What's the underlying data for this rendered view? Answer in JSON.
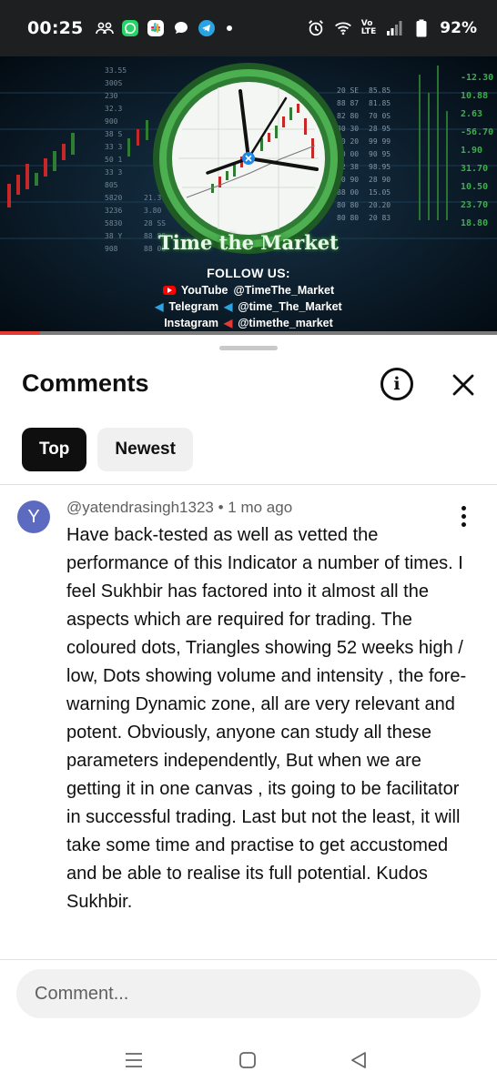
{
  "status_bar": {
    "time": "00:25",
    "left_icons": [
      "group-icon",
      "whatsapp-icon",
      "slack-icon",
      "chat-bubble-icon",
      "telegram-icon",
      "dot-icon"
    ],
    "right_icons": [
      "alarm-icon",
      "wifi-icon",
      "volte-icon",
      "signal-icon",
      "battery-icon"
    ],
    "volte_label_top": "Vo",
    "volte_label_bottom": "LTE",
    "battery": "92%"
  },
  "video": {
    "brand_title": "Time the Market",
    "follow_title": "FOLLOW US:",
    "links": [
      {
        "icon": "youtube-icon",
        "platform": "YouTube",
        "handle": "@TimeThe_Market"
      },
      {
        "icon": "telegram-icon",
        "platform": "Telegram",
        "handle": "@time_The_Market"
      },
      {
        "icon": "instagram-icon",
        "platform": "Instagram",
        "handle": "@timethe_market"
      }
    ],
    "progress_fraction": 0.08,
    "progress_color": "#e53935"
  },
  "comments_sheet": {
    "title": "Comments",
    "info_icon": "info-icon",
    "close_icon": "close-icon",
    "sort_chips": [
      {
        "label": "Top",
        "active": true
      },
      {
        "label": "Newest",
        "active": false
      }
    ],
    "comments": [
      {
        "avatar_letter": "Y",
        "avatar_color": "#5c6bc0",
        "author": "@yatendrasingh1323",
        "time_ago": "1 mo ago",
        "meta": "@yatendrasingh1323 • 1 mo ago",
        "text": "Have back-tested as well as vetted the performance of this Indicator a number of times. I feel Sukhbir has factored into it almost all the aspects which are required for trading. The coloured dots, Triangles showing 52 weeks high / low, Dots showing volume and intensity , the fore-warning Dynamic zone, all are very relevant and potent. Obviously, anyone can study all these parameters independently, But when we are getting it in one canvas , its going to be facilitator in successful trading. Last but not the least, it will take some time and practise to get accustomed and be able to realise its full potential. Kudos Sukhbir."
      }
    ],
    "input_placeholder": "Comment..."
  },
  "nav_bar": {
    "buttons": [
      "recents-icon",
      "home-icon",
      "back-icon"
    ]
  }
}
